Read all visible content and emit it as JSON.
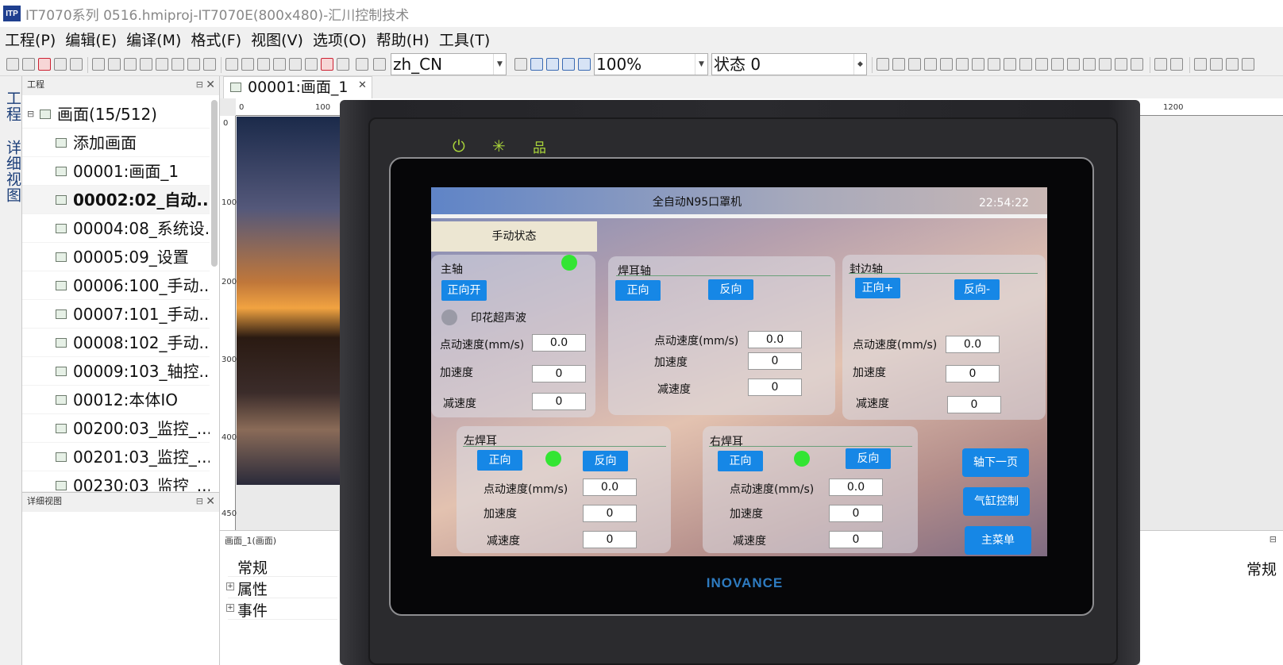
{
  "window": {
    "app_icon": "ITP",
    "title": "IT7070系列 0516.hmiproj-IT7070E(800x480)-汇川控制技术"
  },
  "menu": [
    "工程(P)",
    "编辑(E)",
    "编译(M)",
    "格式(F)",
    "视图(V)",
    "选项(O)",
    "帮助(H)",
    "工具(T)"
  ],
  "toolbar": {
    "language": "zh_CN",
    "zoom": "100%",
    "state": "状态 0"
  },
  "left_tabs": {
    "project": "工程",
    "detail": "详细视图"
  },
  "project_panel": {
    "title": "工程",
    "root": "画面(15/512)",
    "items": [
      "添加画面",
      "00001:画面_1",
      "00002:02_自动...",
      "00004:08_系统设...",
      "00005:09_设置",
      "00006:100_手动...",
      "00007:101_手动...",
      "00008:102_手动...",
      "00009:103_轴控...",
      "00012:本体IO",
      "00200:03_监控_...",
      "00201:03_监控_...",
      "00230:03_监控_..."
    ]
  },
  "detail_panel": {
    "title": "详细视图"
  },
  "document": {
    "tab": "00001:画面_1"
  },
  "ruler": {
    "h": [
      "0",
      "100",
      "1200"
    ],
    "v": [
      "0",
      "100",
      "200",
      "300",
      "400",
      "450"
    ]
  },
  "properties": {
    "title": "画面_1(画面)",
    "items": [
      "常规",
      "属性",
      "事件"
    ],
    "right_label": "常规"
  },
  "device": {
    "brand": "INOVANCE",
    "leds": [
      "power-icon",
      "run-icon",
      "network-icon"
    ]
  },
  "hmi": {
    "title": "全自动N95口罩机",
    "time": "22:54:22",
    "mode": "手动状态",
    "main_axis": {
      "title": "主轴",
      "btn": "正向开",
      "ultrasonic": "印花超声波",
      "jog": "点动速度(mm/s)",
      "jog_val": "0.0",
      "acc": "加速度",
      "acc_val": "0",
      "dec": "减速度",
      "dec_val": "0"
    },
    "weld_axis": {
      "title": "焊耳轴",
      "fwd": "正向",
      "rev": "反向",
      "jog": "点动速度(mm/s)",
      "jog_val": "0.0",
      "acc": "加速度",
      "acc_val": "0",
      "dec": "减速度",
      "dec_val": "0"
    },
    "seal_axis": {
      "title": "封边轴",
      "fwd": "正向+",
      "rev": "反向-",
      "jog": "点动速度(mm/s)",
      "jog_val": "0.0",
      "acc": "加速度",
      "acc_val": "0",
      "dec": "减速度",
      "dec_val": "0"
    },
    "left_ear": {
      "title": "左焊耳",
      "fwd": "正向",
      "rev": "反向",
      "jog": "点动速度(mm/s)",
      "jog_val": "0.0",
      "acc": "加速度",
      "acc_val": "0",
      "dec": "减速度",
      "dec_val": "0"
    },
    "right_ear": {
      "title": "右焊耳",
      "fwd": "正向",
      "rev": "反向",
      "jog": "点动速度(mm/s)",
      "jog_val": "0.0",
      "acc": "加速度",
      "acc_val": "0",
      "dec": "减速度",
      "dec_val": "0"
    },
    "nav": {
      "next": "轴下一页",
      "cylinder": "气缸控制",
      "main": "主菜单"
    }
  },
  "colors": {
    "hmi_button": "#1687e6",
    "led_on": "#33e533",
    "brand": "#2e7bc0"
  }
}
